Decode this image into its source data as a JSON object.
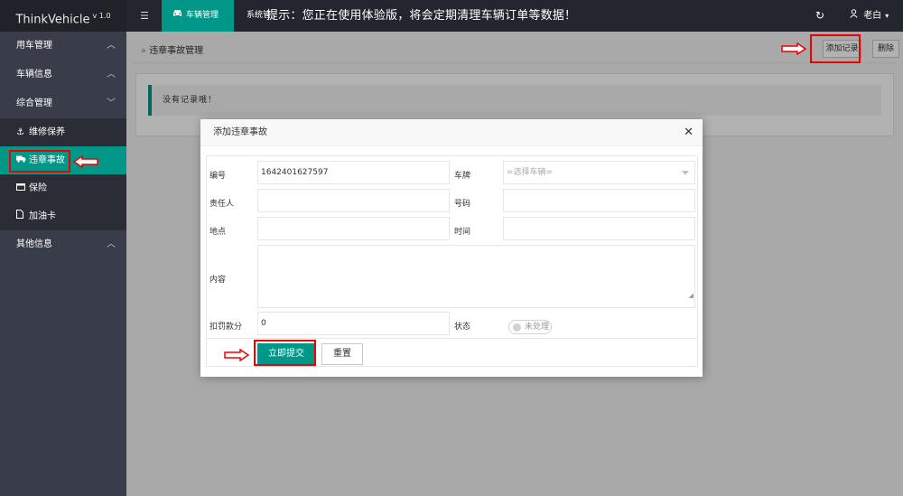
{
  "header": {
    "app_name": "ThinkVehicle",
    "version": "v 1.0",
    "menu_icon": "hamburger-icon",
    "active_tab_icon": "car-icon",
    "active_tab": "车辆管理",
    "second_tab": "系统管",
    "notice": "提示：您正在使用体验版，将会定期清理车辆订单等数据！",
    "refresh_icon": "refresh-icon",
    "user_icon": "user-icon",
    "user_name": "老白"
  },
  "sidebar": {
    "groups": [
      {
        "label": "用车管理",
        "arrow": "up"
      },
      {
        "label": "车辆信息",
        "arrow": "up"
      },
      {
        "label": "综合管理",
        "arrow": "down"
      }
    ],
    "children": [
      {
        "label": "维修保养",
        "icon": "anchor-icon"
      },
      {
        "label": "违章事故",
        "icon": "truck-icon",
        "active": true
      },
      {
        "label": "保险",
        "icon": "card-icon"
      },
      {
        "label": "加油卡",
        "icon": "file-icon"
      }
    ],
    "last_group": {
      "label": "其他信息",
      "arrow": "up"
    }
  },
  "main": {
    "breadcrumb": "违章事故管理",
    "add_button": "添加记录",
    "delete_button": "删除",
    "empty_text": "没有记录哦！"
  },
  "modal": {
    "title": "添加违章事故",
    "fields": {
      "number_label": "编号",
      "number_value": "1642401627597",
      "plate_label": "车牌",
      "plate_placeholder": "=选择车辆=",
      "responsible_label": "责任人",
      "code_label": "号码",
      "location_label": "地点",
      "time_label": "时间",
      "content_label": "内容",
      "deduction_label": "扣罚款分",
      "deduction_value": "0",
      "status_label": "状态",
      "status_value": "未处理"
    },
    "submit_button": "立即提交",
    "reset_button": "重置"
  },
  "colors": {
    "accent": "#009688",
    "sidebar_bg": "#393d49",
    "topbar_bg": "#23262e",
    "annotation": "#e00000"
  }
}
